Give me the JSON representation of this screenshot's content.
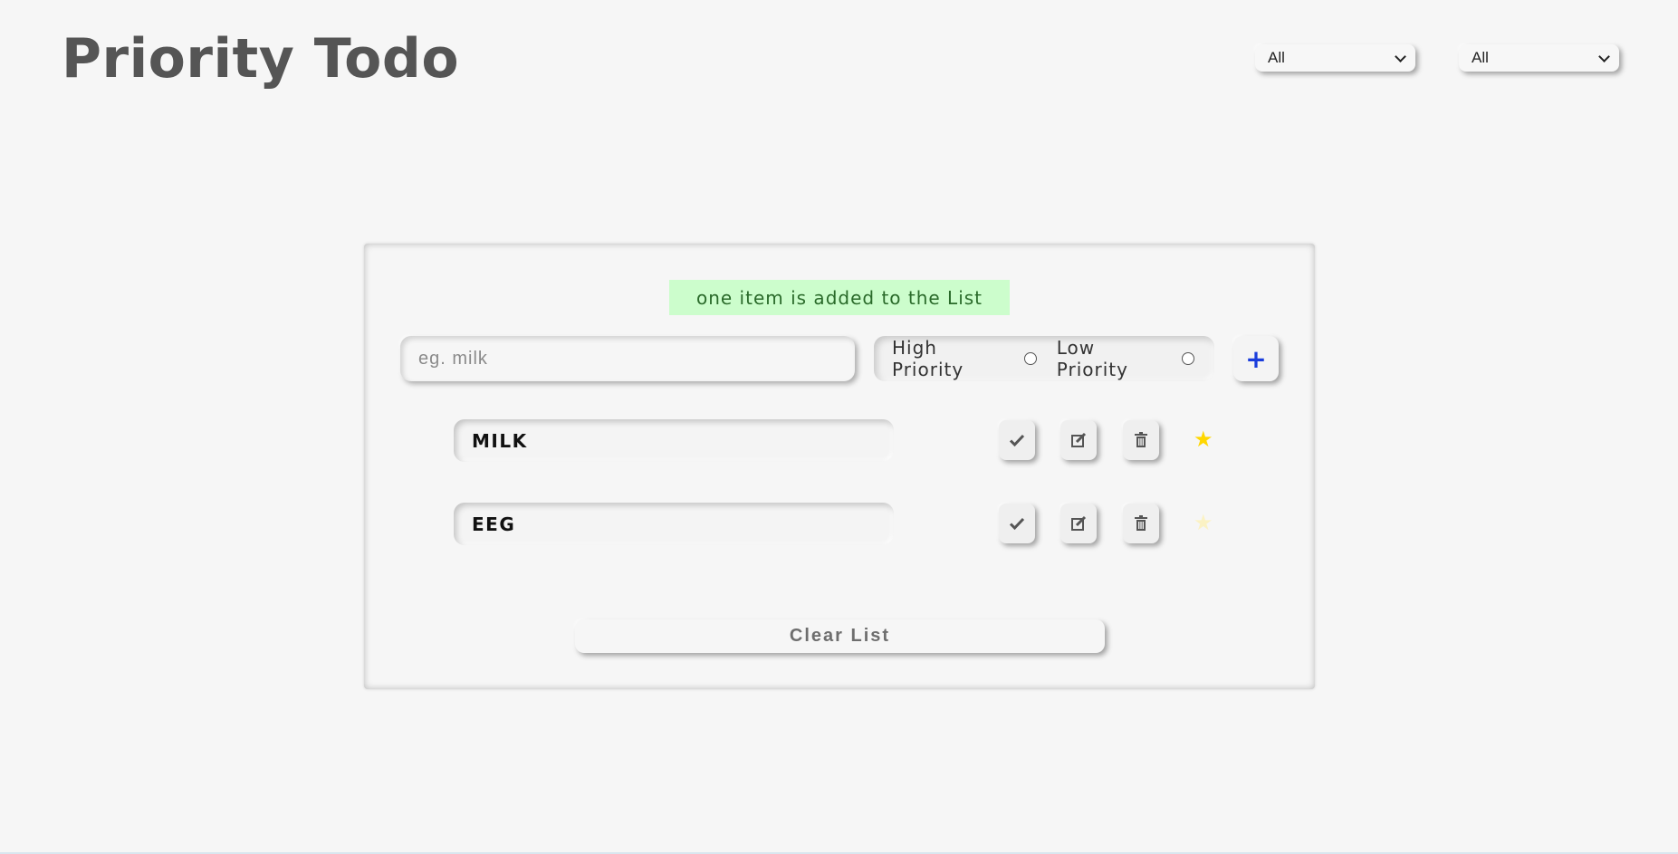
{
  "header": {
    "title": "Priority Todo"
  },
  "filters": [
    {
      "selected": "All"
    },
    {
      "selected": "All"
    }
  ],
  "alert": {
    "text": "one item is added to the List",
    "color": "#ccfdcc"
  },
  "form": {
    "placeholder": "eg. milk",
    "priority_options": [
      "High Priority",
      "Low Priority"
    ],
    "add_label": "+"
  },
  "items": [
    {
      "text": "MILK",
      "starred": true,
      "icons": [
        "check-icon",
        "edit-icon",
        "trash-icon",
        "star-icon"
      ]
    },
    {
      "text": "EEG",
      "starred": false,
      "icons": [
        "check-icon",
        "edit-icon",
        "trash-icon",
        "star-icon"
      ]
    }
  ],
  "clear_label": "Clear List",
  "colors": {
    "star_on": "#ffd700",
    "star_off": "#fbf2c4",
    "plus": "#1a3ddc"
  }
}
